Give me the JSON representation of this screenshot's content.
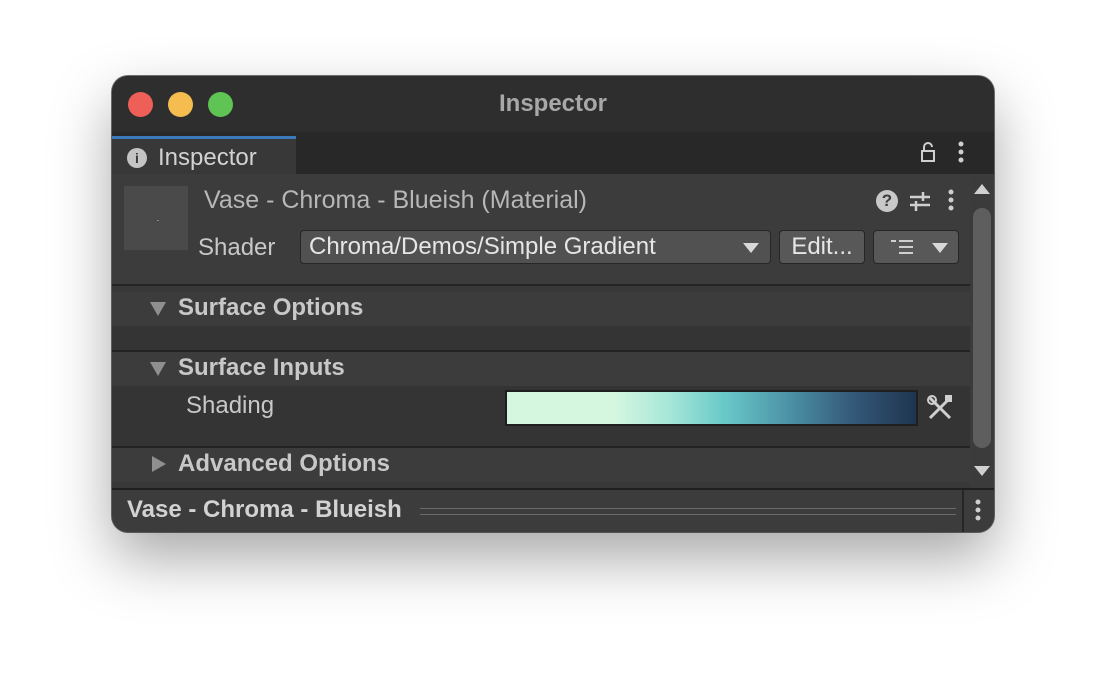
{
  "window": {
    "title": "Inspector"
  },
  "tab": {
    "label": "Inspector",
    "icon": "info-icon"
  },
  "header": {
    "material_title": "Vase - Chroma - Blueish (Material)",
    "shader_label": "Shader",
    "shader_value": "Chroma/Demos/Simple Gradient",
    "edit_label": "Edit...",
    "icons": [
      "help-icon",
      "presets-icon",
      "more-icon"
    ]
  },
  "sections": {
    "surface_options": {
      "title": "Surface Options",
      "expanded": true
    },
    "surface_inputs": {
      "title": "Surface Inputs",
      "expanded": true,
      "shading_label": "Shading",
      "gradient_colors": [
        "#d6f7df",
        "#a5e6d8",
        "#69c9c9",
        "#4a8ea4",
        "#355a7a",
        "#1e3550"
      ]
    },
    "advanced_options": {
      "title": "Advanced Options",
      "expanded": false
    }
  },
  "footer": {
    "title": "Vase - Chroma - Blueish"
  },
  "colors": {
    "window_bg": "#383838",
    "titlebar_bg": "#2e2e2e",
    "tab_accent": "#3a79bb",
    "traffic_close": "#ee5f57",
    "traffic_minimize": "#f5bd4f",
    "traffic_maximize": "#5fc454"
  }
}
